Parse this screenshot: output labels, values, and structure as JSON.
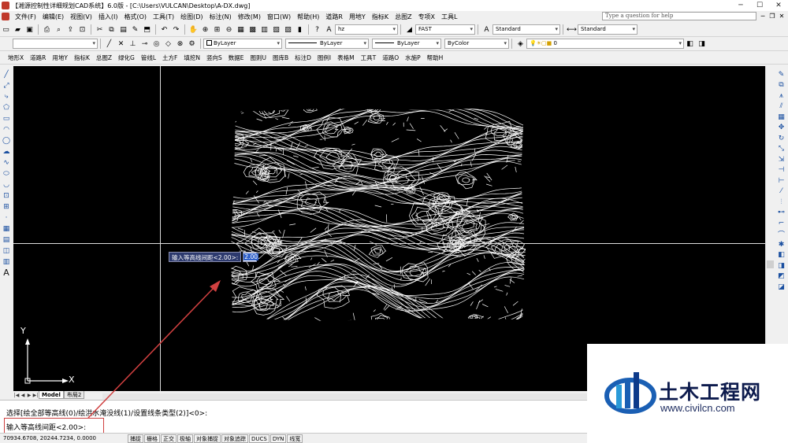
{
  "window": {
    "title": "【湘源控制性详细规划CAD系统】6.0版 - [C:\\Users\\VULCAN\\Desktop\\A-DX.dwg]",
    "minimize": "─",
    "maximize": "☐",
    "close": "✕"
  },
  "menu": {
    "items": [
      "文件(F)",
      "编辑(E)",
      "视图(V)",
      "插入(I)",
      "格式(O)",
      "工具(T)",
      "绘图(D)",
      "标注(N)",
      "修改(M)",
      "窗口(W)",
      "帮助(H)",
      "道路R",
      "用地Y",
      "指标K",
      "总图Z",
      "专项X",
      "工具L"
    ],
    "help_search_placeholder": "Type a question for help"
  },
  "toolbar1": {
    "layer_combo": "hz",
    "linetype_combo": "FAST",
    "textstyle_combo": "Standard",
    "dimstyle_combo": "Standard"
  },
  "toolbar2": {
    "layer_combo": "0",
    "color_combo": "ByLayer",
    "linetype_combo": "ByLayer",
    "lineweight_combo": "ByLayer",
    "plotstyle_combo": "ByColor",
    "layer_state_combo": "0"
  },
  "toolbar3": {
    "items": [
      "地形X",
      "道路R",
      "用地Y",
      "指标K",
      "总图Z",
      "绿化G",
      "管线L",
      "土方F",
      "填挖N",
      "竖向S",
      "数据E",
      "图则U",
      "图库B",
      "标注D",
      "图例I",
      "表格M",
      "工具T",
      "道路O",
      "水施P",
      "帮助H"
    ]
  },
  "canvas": {
    "background": "#000000",
    "ucs_x_label": "X",
    "ucs_y_label": "Y"
  },
  "dynamic_input": {
    "prompt": "输入等高线间距<2.00>:",
    "value": "2.00"
  },
  "tabs": {
    "model": "Model",
    "layout": "布局2"
  },
  "command": {
    "history": "选择[绘全部等高线(0)/绘洪水淹没线(1)/设置线条类型(2)]<0>:",
    "prompt": "输入等高线间距<2.00>:"
  },
  "status": {
    "coords": "70934.6708, 20244.7234, 0.0000",
    "toggles": [
      "捕捉",
      "栅格",
      "正交",
      "极轴",
      "对象捕捉",
      "对象追踪",
      "DUCS",
      "DYN",
      "线宽"
    ]
  },
  "watermark": {
    "title": "土木工程网",
    "url": "www.civilcn.com"
  },
  "colors": {
    "annotation": "#d04040",
    "dyn_label_bg": "#2d3a6e",
    "selection": "#3060c8"
  }
}
